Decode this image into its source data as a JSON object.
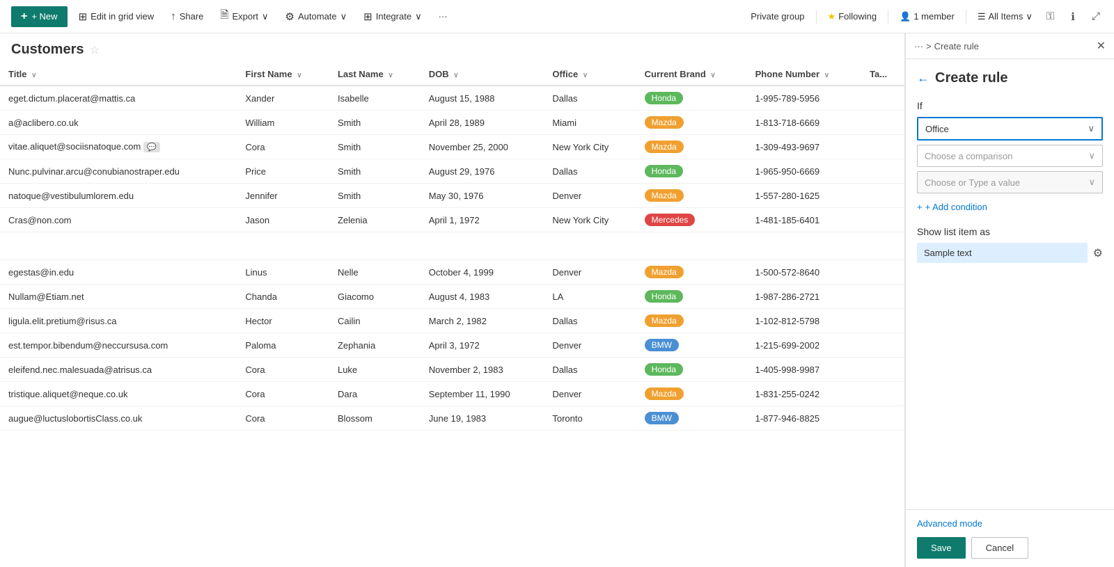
{
  "topBar": {
    "newLabel": "+ New",
    "editGridLabel": "Edit in grid view",
    "shareLabel": "Share",
    "exportLabel": "Export",
    "automateLabel": "Automate",
    "integrateLabel": "Integrate",
    "moreLabel": "···",
    "privateGroup": "Private group",
    "followingLabel": "Following",
    "memberCount": "1 member",
    "allItemsLabel": "All Items"
  },
  "listTitle": "Customers",
  "columns": [
    {
      "id": "title",
      "label": "Title"
    },
    {
      "id": "firstName",
      "label": "First Name"
    },
    {
      "id": "lastName",
      "label": "Last Name"
    },
    {
      "id": "dob",
      "label": "DOB"
    },
    {
      "id": "office",
      "label": "Office"
    },
    {
      "id": "currentBrand",
      "label": "Current Brand"
    },
    {
      "id": "phoneNumber",
      "label": "Phone Number"
    },
    {
      "id": "tag",
      "label": "Ta..."
    }
  ],
  "rows": [
    {
      "title": "eget.dictum.placerat@mattis.ca",
      "firstName": "Xander",
      "lastName": "Isabelle",
      "dob": "August 15, 1988",
      "office": "Dallas",
      "brand": "Honda",
      "brandType": "honda",
      "phone": "1-995-789-5956",
      "hasChat": false
    },
    {
      "title": "a@aclibero.co.uk",
      "firstName": "William",
      "lastName": "Smith",
      "dob": "April 28, 1989",
      "office": "Miami",
      "brand": "Mazda",
      "brandType": "mazda",
      "phone": "1-813-718-6669",
      "hasChat": false
    },
    {
      "title": "vitae.aliquet@sociisnatoque.com",
      "firstName": "Cora",
      "lastName": "Smith",
      "dob": "November 25, 2000",
      "office": "New York City",
      "brand": "Mazda",
      "brandType": "mazda",
      "phone": "1-309-493-9697",
      "hasChat": true
    },
    {
      "title": "Nunc.pulvinar.arcu@conubianostraper.edu",
      "firstName": "Price",
      "lastName": "Smith",
      "dob": "August 29, 1976",
      "office": "Dallas",
      "brand": "Honda",
      "brandType": "honda",
      "phone": "1-965-950-6669",
      "hasChat": false
    },
    {
      "title": "natoque@vestibulumlorem.edu",
      "firstName": "Jennifer",
      "lastName": "Smith",
      "dob": "May 30, 1976",
      "office": "Denver",
      "brand": "Mazda",
      "brandType": "mazda",
      "phone": "1-557-280-1625",
      "hasChat": false
    },
    {
      "title": "Cras@non.com",
      "firstName": "Jason",
      "lastName": "Zelenia",
      "dob": "April 1, 1972",
      "office": "New York City",
      "brand": "Mercedes",
      "brandType": "mercedes",
      "phone": "1-481-185-6401",
      "hasChat": false
    },
    {
      "title": "",
      "firstName": "",
      "lastName": "",
      "dob": "",
      "office": "",
      "brand": "",
      "brandType": "",
      "phone": "",
      "hasChat": false
    },
    {
      "title": "egestas@in.edu",
      "firstName": "Linus",
      "lastName": "Nelle",
      "dob": "October 4, 1999",
      "office": "Denver",
      "brand": "Mazda",
      "brandType": "mazda",
      "phone": "1-500-572-8640",
      "hasChat": false
    },
    {
      "title": "Nullam@Etiam.net",
      "firstName": "Chanda",
      "lastName": "Giacomo",
      "dob": "August 4, 1983",
      "office": "LA",
      "brand": "Honda",
      "brandType": "honda",
      "phone": "1-987-286-2721",
      "hasChat": false
    },
    {
      "title": "ligula.elit.pretium@risus.ca",
      "firstName": "Hector",
      "lastName": "Cailin",
      "dob": "March 2, 1982",
      "office": "Dallas",
      "brand": "Mazda",
      "brandType": "mazda",
      "phone": "1-102-812-5798",
      "hasChat": false
    },
    {
      "title": "est.tempor.bibendum@neccursusa.com",
      "firstName": "Paloma",
      "lastName": "Zephania",
      "dob": "April 3, 1972",
      "office": "Denver",
      "brand": "BMW",
      "brandType": "bmw",
      "phone": "1-215-699-2002",
      "hasChat": false
    },
    {
      "title": "eleifend.nec.malesuada@atrisus.ca",
      "firstName": "Cora",
      "lastName": "Luke",
      "dob": "November 2, 1983",
      "office": "Dallas",
      "brand": "Honda",
      "brandType": "honda",
      "phone": "1-405-998-9987",
      "hasChat": false
    },
    {
      "title": "tristique.aliquet@neque.co.uk",
      "firstName": "Cora",
      "lastName": "Dara",
      "dob": "September 11, 1990",
      "office": "Denver",
      "brand": "Mazda",
      "brandType": "mazda",
      "phone": "1-831-255-0242",
      "hasChat": false
    },
    {
      "title": "augue@luctuslobortisClass.co.uk",
      "firstName": "Cora",
      "lastName": "Blossom",
      "dob": "June 19, 1983",
      "office": "Toronto",
      "brand": "BMW",
      "brandType": "bmw",
      "phone": "1-877-946-8825",
      "hasChat": false
    }
  ],
  "panel": {
    "breadcrumbEllipsis": "···",
    "breadcrumbSeparator": ">",
    "breadcrumbCurrent": "Create rule",
    "title": "Create rule",
    "backArrow": "←",
    "ifLabel": "If",
    "fieldValue": "Office",
    "comparisonPlaceholder": "Choose a comparison",
    "valuePlaceholder": "Choose or Type a value",
    "addConditionLabel": "+ Add condition",
    "showAsLabel": "Show list item as",
    "sampleText": "Sample text",
    "advancedMode": "Advanced mode",
    "saveLabel": "Save",
    "cancelLabel": "Cancel"
  }
}
